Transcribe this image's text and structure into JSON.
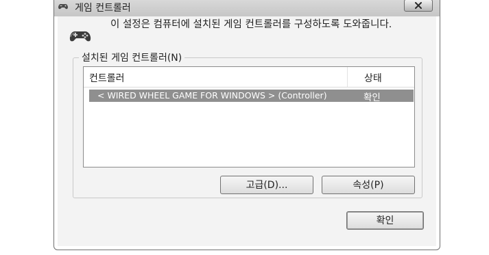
{
  "window": {
    "title": "게임 컨트롤러"
  },
  "icons": {
    "title_icon": "gamepad-icon",
    "close": "close-icon",
    "description_icon": "gamepad-icon"
  },
  "description": "이 설정은 컴퓨터에 설치된 게임 컨트롤러를 구성하도록 도와줍니다.",
  "installed_group": {
    "label": "설치된 게임 컨트롤러(N)",
    "columns": [
      "컨트롤러",
      "상태"
    ],
    "rows": [
      {
        "name": "< WIRED WHEEL GAME FOR WINDOWS > (Controller)",
        "status": "확인",
        "selected": true
      }
    ],
    "advanced_button": "고급(D)...",
    "properties_button": "속성(P)"
  },
  "ok_button": "확인",
  "colors": {
    "selection": "#8f8f8f",
    "dialog_bg": "#f3f3f3",
    "titlebar": "#d0d0d0"
  }
}
